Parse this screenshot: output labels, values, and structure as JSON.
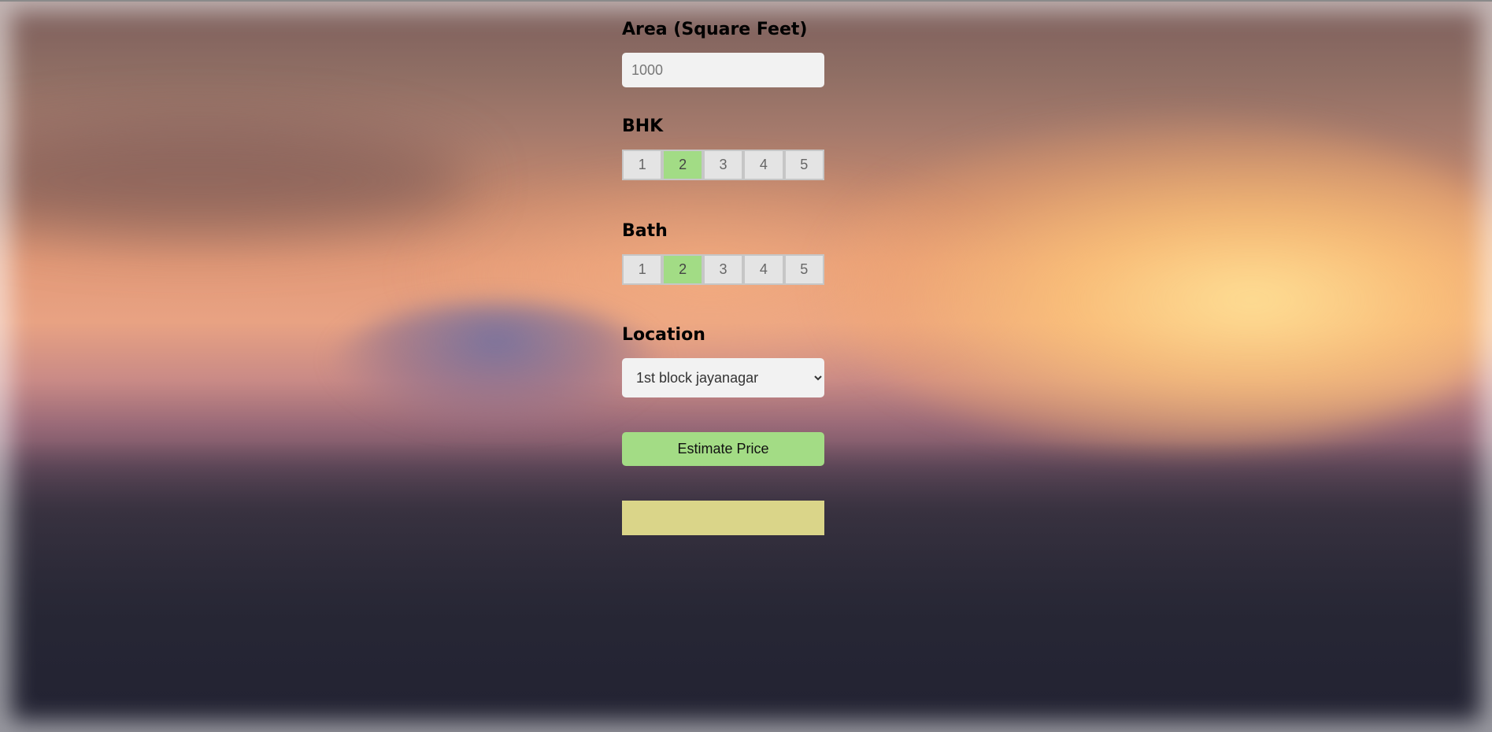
{
  "form": {
    "area": {
      "label": "Area (Square Feet)",
      "value": "",
      "placeholder": "1000"
    },
    "bhk": {
      "label": "BHK",
      "options": [
        "1",
        "2",
        "3",
        "4",
        "5"
      ],
      "selected": "2"
    },
    "bath": {
      "label": "Bath",
      "options": [
        "1",
        "2",
        "3",
        "4",
        "5"
      ],
      "selected": "2"
    },
    "location": {
      "label": "Location",
      "selected": "1st block jayanagar"
    },
    "estimate_button_label": "Estimate Price",
    "result_text": ""
  },
  "colors": {
    "active_segment": "#a2dc85",
    "estimate_button": "#a3dc85",
    "result_box": "#dad589",
    "input_background": "#f2f2f2"
  }
}
